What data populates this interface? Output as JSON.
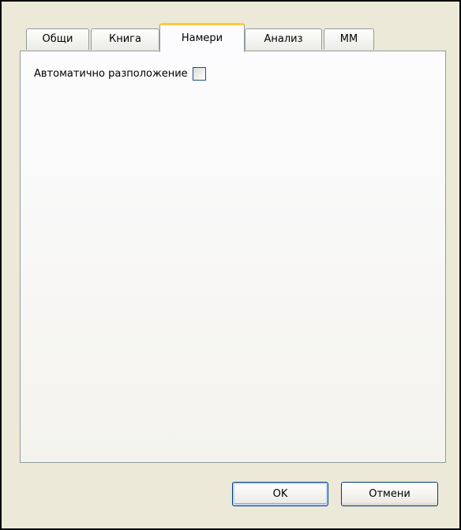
{
  "tabs": [
    {
      "label": "Общи",
      "active": false
    },
    {
      "label": "Книга",
      "active": false
    },
    {
      "label": "Намери",
      "active": true
    },
    {
      "label": "Анализ",
      "active": false
    },
    {
      "label": "MM",
      "active": false
    }
  ],
  "panel": {
    "auto_layout_label": "Автоматично разположение",
    "auto_layout_checked": false
  },
  "buttons": {
    "ok_label": "OK",
    "cancel_label": "Отмени"
  },
  "colors": {
    "dialog_bg": "#ece9d8",
    "active_tab_accent": "#ffc83c",
    "default_button_border": "#003c74"
  }
}
